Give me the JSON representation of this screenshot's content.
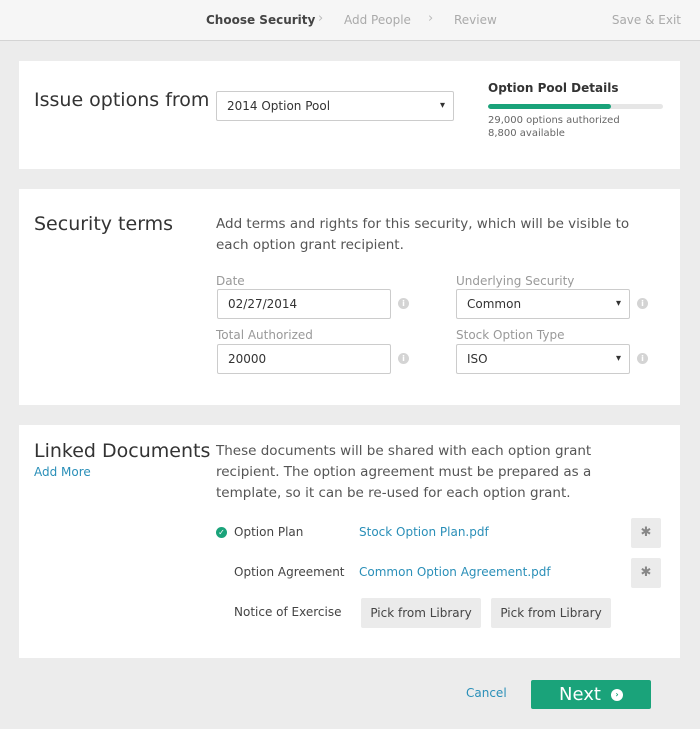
{
  "nav": {
    "steps": [
      "Choose Security",
      "Add People",
      "Review"
    ],
    "active_step": "Choose Security",
    "save_exit": "Save & Exit",
    "chevron_icon": "chevron-right-icon"
  },
  "issue_options": {
    "title": "Issue options from",
    "pool_select": "2014 Option Pool",
    "pool_details": {
      "title": "Option Pool Details",
      "authorized": "29,000 options authorized",
      "available": "8,800 available",
      "used_fraction": 0.7
    }
  },
  "security_terms": {
    "title": "Security terms",
    "description": "Add terms and rights for this security, which will be visible to each option grant recipient.",
    "date_label": "Date",
    "date_value": "02/27/2014",
    "total_authorized_label": "Total Authorized",
    "total_authorized_value": "20000",
    "underlying_security_label": "Underlying Security",
    "underlying_security_value": "Common",
    "stock_option_type_label": "Stock Option Type",
    "stock_option_type_value": "ISO",
    "info_glyph": "i"
  },
  "linked_documents": {
    "title": "Linked Documents",
    "add_more": "Add More",
    "description": "These documents will be shared with each option grant recipient. The option agreement must be prepared as a template, so it can be re-used for each option grant.",
    "documents": [
      {
        "label": "Option Plan",
        "file": "Stock Option Plan.pdf",
        "checked": true
      },
      {
        "label": "Option Agreement",
        "file": "Common Option Agreement.pdf",
        "checked": false
      },
      {
        "label": "Notice of Exercise",
        "file": "",
        "checked": false
      }
    ],
    "pick_from_library": "Pick from Library"
  },
  "footer": {
    "cancel": "Cancel",
    "next": "Next"
  },
  "colors": {
    "accent": "#1aa37a",
    "link": "#2a8fb8",
    "background": "#ececec"
  }
}
